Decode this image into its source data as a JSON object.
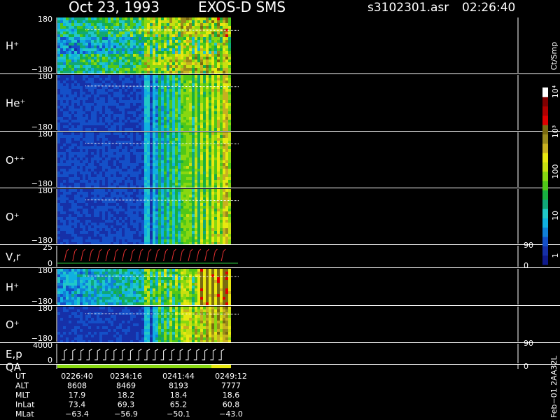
{
  "header": {
    "date": "Oct 23, 1993",
    "instrument": "EXOS-D SMS",
    "file": "s3102301.asr",
    "time": "02:26:40"
  },
  "colors": {
    "background": "#000000",
    "text": "#ffffff",
    "scale": [
      "#0f1a8c",
      "#1630a8",
      "#1450c8",
      "#1080d8",
      "#10b0e0",
      "#20c8c8",
      "#10a878",
      "#18b040",
      "#50c818",
      "#88d810",
      "#c8e010",
      "#e8e810",
      "#c8b020",
      "#9a8a1c",
      "#7a6a10",
      "#e00000",
      "#b00000",
      "#800000",
      "#ffffff"
    ]
  },
  "colorbar": {
    "unit_label": "Ct/Smp",
    "ticks": [
      "1",
      "10",
      "100",
      "10³",
      "10⁴"
    ]
  },
  "chart_data": {
    "type": "heatmap",
    "panels": [
      {
        "id": "h-plus",
        "label": "H⁺",
        "y_top": "180",
        "y_bottom": "−180"
      },
      {
        "id": "he-plus",
        "label": "He⁺",
        "y_top": "180",
        "y_bottom": "−180"
      },
      {
        "id": "o-plusplus",
        "label": "O⁺⁺",
        "y_top": "180",
        "y_bottom": "−180"
      },
      {
        "id": "o-plus",
        "label": "O⁺",
        "y_top": "180",
        "y_bottom": "−180"
      },
      {
        "id": "vr",
        "label": "V,r",
        "y_top": "25",
        "y_bottom": "0",
        "right_top": "90",
        "right_bottom": "0"
      },
      {
        "id": "h-plus-2",
        "label": "H⁺",
        "y_top": "180",
        "y_bottom": "−180"
      },
      {
        "id": "o-plus-2",
        "label": "O⁺",
        "y_top": "180",
        "y_bottom": "−180"
      },
      {
        "id": "ep",
        "label": "E,p",
        "y_top": "4000",
        "y_bottom": "0",
        "right_top": "90",
        "right_bottom": "0"
      },
      {
        "id": "qa",
        "label": "QA"
      }
    ],
    "x_ticks": [
      "0226:40",
      "0234:16",
      "0241:44",
      "0249:12"
    ],
    "orbit": {
      "labels": [
        "UT",
        "ALT",
        "MLT",
        "InLat",
        "MLat"
      ],
      "rows": [
        [
          "0226:40",
          "0234:16",
          "0241:44",
          "0249:12"
        ],
        [
          "8608",
          "8469",
          "8193",
          "7777"
        ],
        [
          "17.9",
          "18.2",
          "18.4",
          "18.6"
        ],
        [
          "73.4",
          "69.3",
          "65.2",
          "60.8"
        ],
        [
          "−63.4",
          "−56.9",
          "−50.1",
          "−43.0"
        ]
      ]
    }
  },
  "footer": {
    "stamp": "Feb−01 2AA32L"
  }
}
